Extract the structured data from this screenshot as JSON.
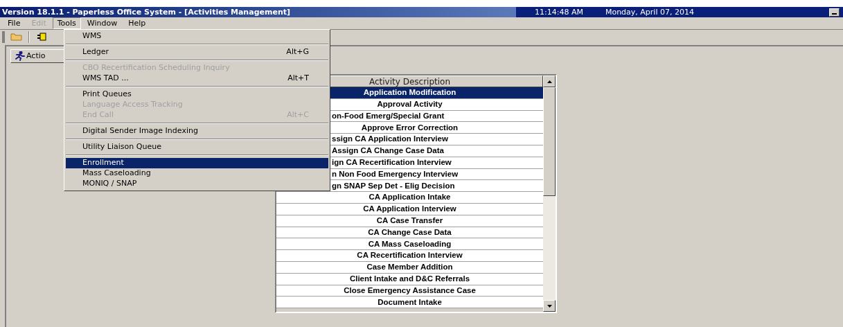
{
  "window": {
    "title": "Version 18.1.1 - Paperless Office System - [Activities Management]",
    "time": "11:14:48 AM",
    "date": "Monday, April 07, 2014"
  },
  "menu_bar": [
    {
      "label": "File",
      "disabled": false,
      "selected": false
    },
    {
      "label": "Edit",
      "disabled": true,
      "selected": false
    },
    {
      "label": "Tools",
      "disabled": false,
      "selected": true
    },
    {
      "label": "Window",
      "disabled": false,
      "selected": false
    },
    {
      "label": "Help",
      "disabled": false,
      "selected": false
    }
  ],
  "tools_menu": [
    {
      "kind": "item",
      "label": "WMS",
      "disabled": false,
      "selected": false
    },
    {
      "kind": "separator"
    },
    {
      "kind": "item",
      "label": "Ledger",
      "shortcut": "Alt+G",
      "disabled": false,
      "selected": false
    },
    {
      "kind": "separator"
    },
    {
      "kind": "item",
      "label": "CBO Recertification Scheduling Inquiry",
      "disabled": true,
      "selected": false
    },
    {
      "kind": "item",
      "label": "WMS TAD ...",
      "shortcut": "Alt+T",
      "disabled": false,
      "selected": false
    },
    {
      "kind": "separator"
    },
    {
      "kind": "item",
      "label": "Print Queues",
      "disabled": false,
      "selected": false
    },
    {
      "kind": "item",
      "label": "Language Access Tracking",
      "disabled": true,
      "selected": false
    },
    {
      "kind": "item",
      "label": "End Call",
      "shortcut": "Alt+C",
      "disabled": true,
      "selected": false
    },
    {
      "kind": "separator"
    },
    {
      "kind": "item",
      "label": "Digital Sender Image Indexing",
      "disabled": false,
      "selected": false
    },
    {
      "kind": "separator"
    },
    {
      "kind": "item",
      "label": "Utility Liaison Queue",
      "disabled": false,
      "selected": false
    },
    {
      "kind": "separator"
    },
    {
      "kind": "item",
      "label": "Enrollment",
      "disabled": false,
      "selected": true
    },
    {
      "kind": "item",
      "label": "Mass Caseloading",
      "disabled": false,
      "selected": false
    },
    {
      "kind": "item",
      "label": "MONIQ / SNAP",
      "disabled": false,
      "selected": false
    }
  ],
  "tab": {
    "label": "Actio"
  },
  "activity_list": {
    "column": "Activity Description",
    "rows": [
      {
        "text": "Application Modification",
        "selected": true,
        "clipped": false
      },
      {
        "text": "Approval Activity",
        "selected": false,
        "clipped": false
      },
      {
        "text": "on-Food Emerg/Special Grant",
        "selected": false,
        "clipped": true
      },
      {
        "text": "Approve Error Correction",
        "selected": false,
        "clipped": false
      },
      {
        "text": "ssign CA Application Interview",
        "selected": false,
        "clipped": true
      },
      {
        "text": "Assign CA Change Case Data",
        "selected": false,
        "clipped": true
      },
      {
        "text": "ign CA Recertification Interview",
        "selected": false,
        "clipped": true
      },
      {
        "text": "n Non Food Emergency Interview",
        "selected": false,
        "clipped": true
      },
      {
        "text": "gn SNAP Sep Det - Elig Decision",
        "selected": false,
        "clipped": true
      },
      {
        "text": "CA Application Intake",
        "selected": false,
        "clipped": false
      },
      {
        "text": "CA Application Interview",
        "selected": false,
        "clipped": false
      },
      {
        "text": "CA Case Transfer",
        "selected": false,
        "clipped": false
      },
      {
        "text": "CA Change Case Data",
        "selected": false,
        "clipped": false
      },
      {
        "text": "CA Mass Caseloading",
        "selected": false,
        "clipped": false
      },
      {
        "text": "CA Recertification Interview",
        "selected": false,
        "clipped": false
      },
      {
        "text": "Case Member Addition",
        "selected": false,
        "clipped": false
      },
      {
        "text": "Client Intake and D&C Referrals",
        "selected": false,
        "clipped": false
      },
      {
        "text": "Close Emergency Assistance Case",
        "selected": false,
        "clipped": false
      },
      {
        "text": "Document Intake",
        "selected": false,
        "clipped": false
      }
    ]
  }
}
